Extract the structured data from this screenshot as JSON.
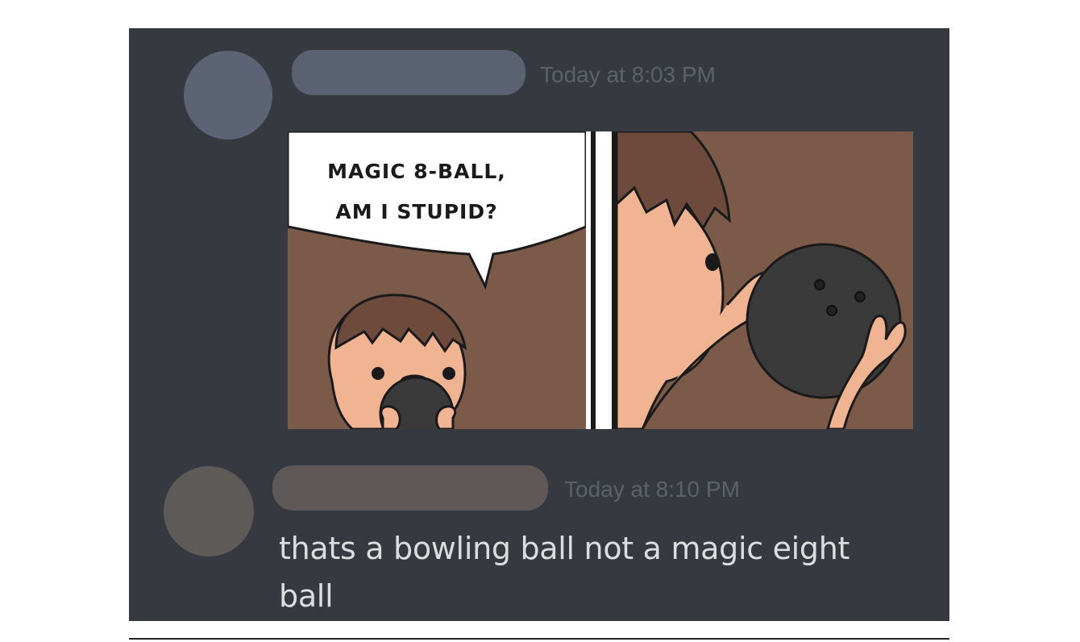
{
  "colors": {
    "background": "#36393f",
    "name_pill": "#5a6272",
    "name_pill_2": "#5e5958",
    "avatar_1": "#5c6375",
    "avatar_2": "#5e5a58",
    "timestamp": "#5d6169",
    "message_text": "#dcddde"
  },
  "messages": [
    {
      "timestamp": "Today at 8:03 PM",
      "attachment": {
        "type": "comic",
        "speech_line_1": "MAGIC 8-BALL,",
        "speech_line_2": "AM I STUPID?"
      }
    },
    {
      "timestamp": "Today at 8:10 PM",
      "text": "thats a bowling ball not a magic eight ball"
    }
  ]
}
